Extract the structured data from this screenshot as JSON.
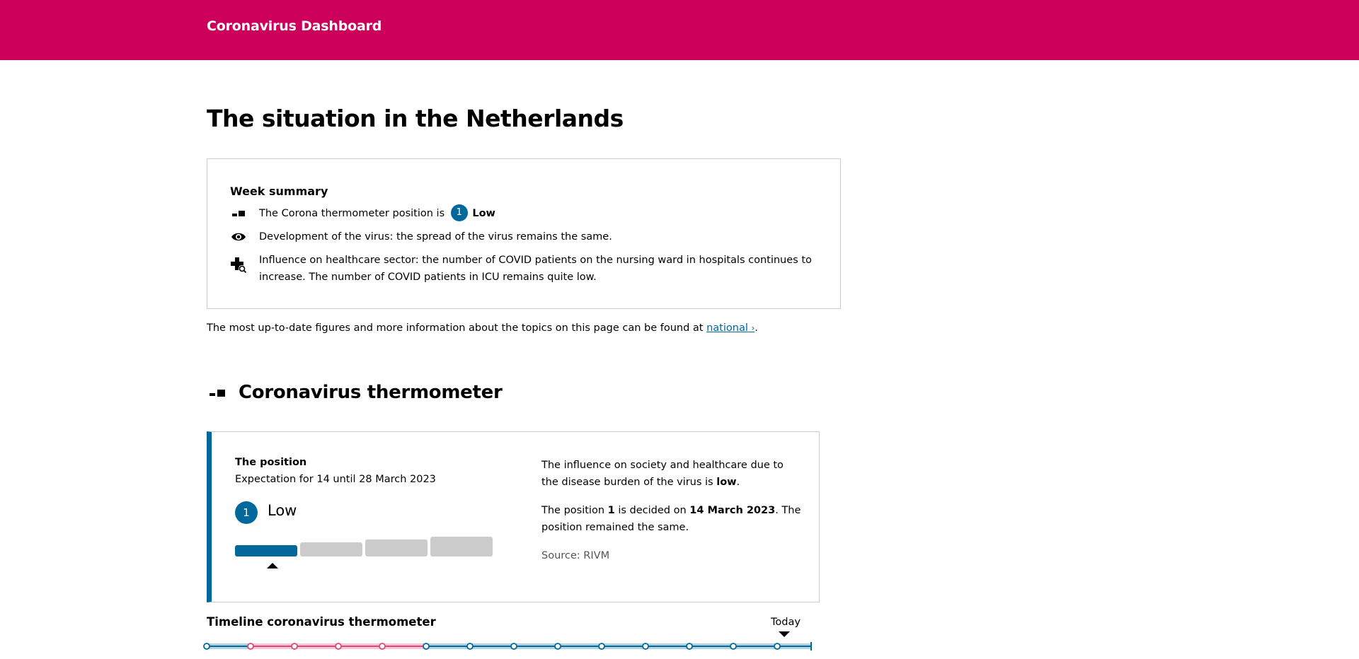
{
  "header": {
    "title": "Coronavirus Dashboard"
  },
  "page": {
    "title": "The situation in the Netherlands"
  },
  "summary": {
    "title": "Week summary",
    "thermometer_text": "The Corona thermometer position is",
    "level_number": "1",
    "level_label": "Low",
    "virus_text": "Development of the virus: the spread of the virus remains the same.",
    "healthcare_text": "Influence on healthcare sector: the number of COVID patients on the nursing ward in hospitals continues to increase. The number of COVID patients in ICU remains quite low."
  },
  "note": {
    "prefix": "The most up-to-date figures and more information about the topics on this page can be found at",
    "link_label": "national",
    "suffix": "."
  },
  "thermometer": {
    "section_title": "Coronavirus thermometer",
    "position_label": "The position",
    "expectation": "Expectation for 14 until 28 March 2023",
    "level_number": "1",
    "level_label": "Low",
    "scale": {
      "levels": 4,
      "active_level": 1,
      "active_color": "#01689b",
      "inactive_color": "#cccccc"
    },
    "influence_prefix": "The influence on society and healthcare due to the disease burden of the virus is",
    "influence_level": "low",
    "decided_prefix": "The position",
    "decided_number": "1",
    "decided_middle": "is decided on",
    "decided_date": "14 March 2023",
    "decided_suffix": ". The position remained the same.",
    "source": "Source: RIVM"
  },
  "timeline": {
    "title": "Timeline coronavirus thermometer",
    "today_label": "Today",
    "segment_levels": [
      1,
      2,
      2,
      2,
      2,
      1,
      1,
      1,
      1,
      1,
      1,
      1,
      1,
      1
    ],
    "level_colors": {
      "1": "#01689b",
      "2": "#e0457b"
    },
    "today_index": 13
  },
  "colors": {
    "brand": "#cc005a",
    "accent": "#01689b"
  },
  "icons": {
    "thermometer": "thermometer-icon",
    "virus": "eye-icon",
    "healthcare": "hospital-cross-icon",
    "link": "chevron-right-icon"
  }
}
